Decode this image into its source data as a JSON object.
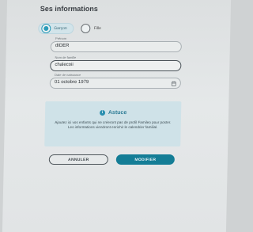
{
  "form": {
    "title": "Ses informations",
    "gender": {
      "options": [
        {
          "label": "Garçon",
          "selected": true
        },
        {
          "label": "Fille",
          "selected": false
        }
      ]
    },
    "fields": {
      "first_name": {
        "label": "Prénom",
        "value": "dIDER"
      },
      "last_name": {
        "label": "Nom de famille",
        "value": "chalecoii"
      },
      "birth_date": {
        "label": "Date de naissance",
        "value": "01 octobre 1979",
        "icon": "calendar-icon"
      }
    },
    "tip": {
      "icon": "info-icon",
      "title": "Astuce",
      "text": "Ajoutez ici vos enfants qui ne créeront pas de profil Famileo pour poster. Les informations viendront enrichir le calendrier familial."
    },
    "buttons": {
      "cancel": "ANNULER",
      "submit": "MODIFIER"
    }
  },
  "colors": {
    "accent": "#147d96",
    "tip_background": "#cfe2e8"
  }
}
